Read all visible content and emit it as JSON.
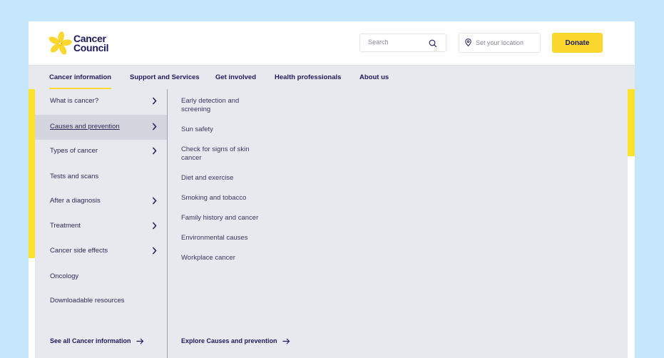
{
  "brand": {
    "name_line1": "Cancer",
    "name_line2": "Council",
    "logo_color": "#fcd72e",
    "text_color": "#1e1a5e"
  },
  "header": {
    "search": {
      "placeholder": "Search",
      "value": ""
    },
    "location": {
      "placeholder": "Set your location"
    },
    "donate_label": "Donate",
    "accent": "#fcd72e"
  },
  "nav": {
    "items": [
      {
        "label": "Cancer information",
        "active": true
      },
      {
        "label": "Support and Services",
        "active": false
      },
      {
        "label": "Get involved",
        "active": false
      },
      {
        "label": "Health professionals",
        "active": false
      },
      {
        "label": "About us",
        "active": false
      }
    ]
  },
  "menu": {
    "level1": [
      {
        "label": "What is cancer?",
        "has_children": true
      },
      {
        "label": "Causes and prevention",
        "has_children": true,
        "selected": true
      },
      {
        "label": "Types of cancer",
        "has_children": true
      },
      {
        "label": "Tests and scans",
        "has_children": false
      },
      {
        "label": "After a diagnosis",
        "has_children": true
      },
      {
        "label": "Treatment",
        "has_children": true
      },
      {
        "label": "Cancer side effects",
        "has_children": true
      },
      {
        "label": "Oncology",
        "has_children": false
      },
      {
        "label": "Downloadable resources",
        "has_children": false
      }
    ],
    "level1_footer": "See all Cancer information",
    "level2": [
      {
        "label": "Early detection and screening"
      },
      {
        "label": "Sun safety"
      },
      {
        "label": "Check for signs of skin cancer"
      },
      {
        "label": "Diet and exercise"
      },
      {
        "label": "Smoking and tobacco"
      },
      {
        "label": "Family history and cancer"
      },
      {
        "label": "Environmental causes"
      },
      {
        "label": "Workplace cancer"
      }
    ],
    "level2_footer": "Explore Causes and prevention"
  }
}
